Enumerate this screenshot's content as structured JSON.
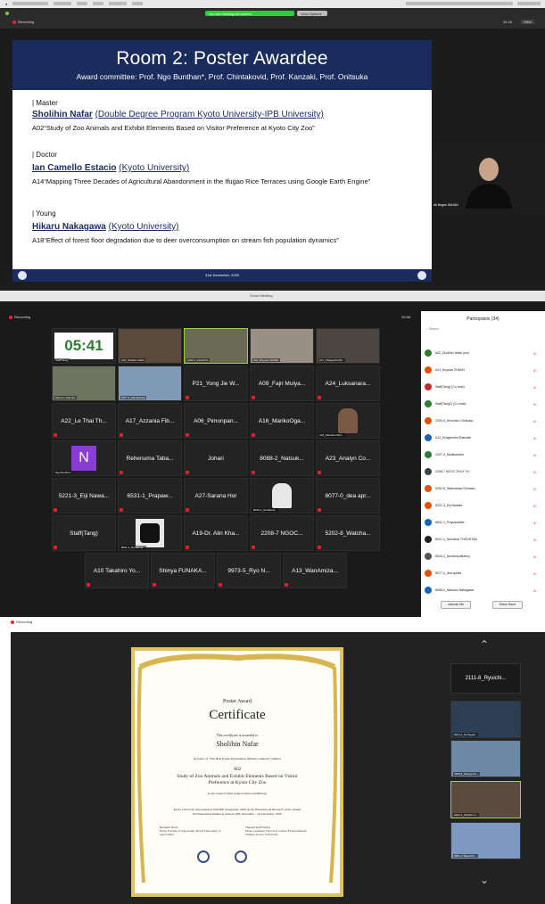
{
  "panel1": {
    "recording_label": "Recording",
    "share_banner": "You are viewing the screen",
    "share_button": "View Options",
    "view_label": "View",
    "timer": "34:26",
    "slide": {
      "title": "Room 2: Poster Awardee",
      "subtitle": "Award committee: Prof. Ngo Bunthan*, Prof. Chintakovid, Prof. Kanzaki, Prof. Onitsuka",
      "sections": [
        {
          "category": "| Master",
          "name": "Sholihin Nafar",
          "affiliation": "(Double Degree Program Kyoto University-IPB University)",
          "desc": "A02“Study of Zoo Animals and Exhibit Elements Based on Visitor Preference at Kyoto City Zoo”"
        },
        {
          "category": "| Doctor",
          "name": "Ian Camello Estacio",
          "affiliation": "(Kyoto University)",
          "desc": "A14“Mapping Three Decades of Agricultural Abandonment in the Ifugao Rice Terraces using Google Earth Engine”"
        },
        {
          "category": "| Young",
          "name": "Hikaru Nakagawa",
          "affiliation": "(Kyoto University)",
          "desc": "A18“Effect of forest floor degradation due to deer overconsumption on stream fish population dynamics”"
        }
      ],
      "footer_date": "31st December, 2020"
    },
    "speaker_name": "Ali Beges SAHAN"
  },
  "panel2": {
    "window_title": "Zoom Meeting",
    "recording_label": "Recording",
    "timer": "26:58",
    "tiles_row1": [
      "Staff(Tang)",
      "A02_Sholihin Nafar",
      "2202-1_Kenichiro",
      "A01_Boyuan ZHANG",
      "A17_Khagendra Bi..."
    ],
    "timer_display": "05:41",
    "tiles_row2": [
      "Mamoru Kanzaki",
      "2207-3_Manikandan",
      "P21_Yong Jie W...",
      "A09_Fajri Mulya...",
      "A24_Luksanara..."
    ],
    "tiles_row3": [
      "A22_Le Thai Th...",
      "A17_Azzania Fib...",
      "A06_Pimonpan...",
      "A16_MarikoOga...",
      "A26_Marietta Palm..."
    ],
    "tiles_row4": [
      "Ngo Bunthan",
      "Rehenuma Taba...",
      "Johari",
      "8088-2_Natsuk...",
      "A23_Analyn Co..."
    ],
    "n_letter": "N",
    "tiles_row5": [
      "5221-3_Eiji Nawa...",
      "6531-1_Prapaw...",
      "A27-Sarana Hor",
      "8026-2_Nurbahna...",
      "8077-0_dea apr..."
    ],
    "tiles_row6": [
      "Staff(Tang)",
      "8021-1_Nurbahna...",
      "A19-Dr. Alin Kha...",
      "2208-7 NGOC...",
      "5202-8_Watcha..."
    ],
    "tiles_row7": [
      "A10 Takahiro Yo...",
      "Shinya FUNAKA...",
      "9973-5_Ryo N...",
      "A13_WanAmiza..."
    ],
    "participants": {
      "header": "Participants (34)",
      "search_placeholder": "Search",
      "items": [
        {
          "name": "A02_Sholihin Nafar (me)",
          "color": "#2e7d32"
        },
        {
          "name": "A01_Boyuan ZHANG",
          "color": "#e65100"
        },
        {
          "name": "Staff(Tang) (Co-host)",
          "color": "#c62828"
        },
        {
          "name": "Staff(Tang2) (Co-host)",
          "color": "#2e7d32"
        },
        {
          "name": "2200-9_Kenichiro Onitsuka",
          "color": "#e65100"
        },
        {
          "name": "A12_Khagendra Bhandari",
          "color": "#1565c0"
        },
        {
          "name": "2207-3_Manikandan",
          "color": "#2e7d32"
        },
        {
          "name": "2208-7 NGOC THUY VU",
          "color": "#37474f"
        },
        {
          "name": "5202-8_Watcharaa Chintako...",
          "color": "#e65100"
        },
        {
          "name": "5221-3_Eiji Nawata",
          "color": "#e65100"
        },
        {
          "name": "6531-1_Prapawadee...",
          "color": "#1565c0"
        },
        {
          "name": "8021-1_Nurbahia THOHSTAN",
          "color": "#222222"
        },
        {
          "name": "8026-2_NurdindyaNanny",
          "color": "#555555"
        },
        {
          "name": "8077-0_dea aprilia",
          "color": "#e65100"
        },
        {
          "name": "8088-2_Natsuko Nakagawa",
          "color": "#1565c0"
        }
      ],
      "unmute_label": "Unmute Me",
      "raise_hand_label": "Raise Hand"
    }
  },
  "panel3": {
    "recording_label": "Recording",
    "certificate": {
      "award": "Poster Award",
      "title": "Certificate",
      "presented": "This certificate is awarded to",
      "name": "Sholihin Nafar",
      "category_line": "In honor of “The Best Poster Presentation (Master's student)” entitled",
      "code": "A02",
      "work": "Study of Zoo Animals and Exhibit Elements Based on Visitor Preference at Kyoto City Zoo",
      "field": "In the research field of Agriculture and Biology",
      "event": "Kyoto University International ONLINE Symposium 2020 on the Education & Research of the Global Environmental Studies in Asia on 30th November - 1st December, 2020",
      "sig1_name": "Bunthan NGO",
      "sig1_title": "Dean, Faculty of Agronomy, Royal University of Agriculture",
      "sig2_name": "Takeshi KATSURA",
      "sig2_title": "Dean, Graduate School of Global Environmental Studies, Kyoto University"
    },
    "videos": [
      "2111-8_Ryuichi...",
      "8324-4_Nurhayati...",
      "7965-8_Shinya FU...",
      "2202-4_Sholihin N...",
      "9981-2 Takeshi K..."
    ]
  }
}
